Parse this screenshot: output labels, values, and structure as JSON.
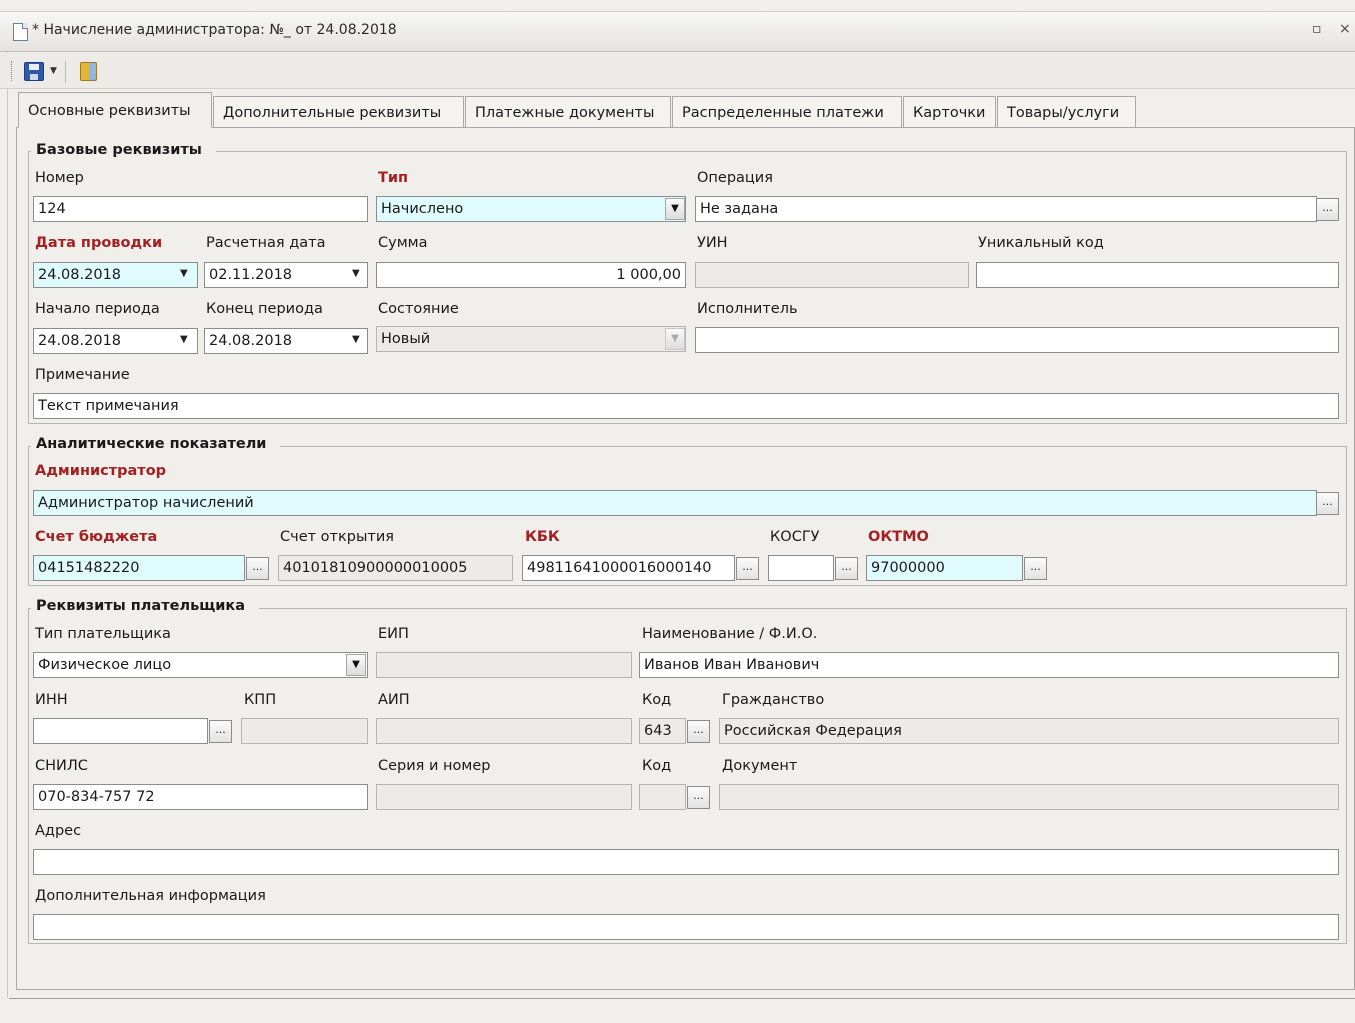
{
  "window": {
    "title": "* Начисление администратора: №_ от 24.08.2018",
    "restore_glyph": "▫",
    "close_glyph": "×"
  },
  "toolbar": {
    "save_icon": "save-icon",
    "exit_icon": "exit-icon"
  },
  "tabs": [
    "Основные реквизиты",
    "Дополнительные реквизиты",
    "Платежные документы",
    "Распределенные платежи",
    "Карточки",
    "Товары/услуги"
  ],
  "base": {
    "title": "Базовые реквизиты",
    "nomer_label": "Номер",
    "nomer_value": "124",
    "tip_label": "Тип",
    "tip_value": "Начислено",
    "operation_label": "Операция",
    "operation_value": "Не задана",
    "date_label": "Дата проводки",
    "date_value": "24.08.2018",
    "calc_date_label": "Расчетная дата",
    "calc_date_value": "02.11.2018",
    "sum_label": "Сумма",
    "sum_value": "1 000,00",
    "uin_label": "УИН",
    "uin_value": "",
    "unique_label": "Уникальный код",
    "unique_value": "",
    "period_start_label": "Начало периода",
    "period_start_value": "24.08.2018",
    "period_end_label": "Конец периода",
    "period_end_value": "24.08.2018",
    "state_label": "Состояние",
    "state_value": "Новый",
    "executor_label": "Исполнитель",
    "executor_value": "",
    "note_label": "Примечание",
    "note_value": "Текст примечания"
  },
  "analytics": {
    "title": "Аналитические показатели",
    "admin_label": "Администратор",
    "admin_value": "Администратор начислений",
    "budget_label": "Счет бюджета",
    "budget_value": "04151482220",
    "open_label": "Счет открытия",
    "open_value": "40101810900000010005",
    "kbk_label": "КБК",
    "kbk_value": "49811641000016000140",
    "kosgu_label": "КОСГУ",
    "kosgu_value": "",
    "oktmo_label": "ОКТМО",
    "oktmo_value": "97000000"
  },
  "payer": {
    "title": "Реквизиты плательщика",
    "type_label": "Тип плательщика",
    "type_value": "Физическое лицо",
    "eip_label": "ЕИП",
    "eip_value": "",
    "name_label": "Наименование / Ф.И.О.",
    "name_value": "Иванов Иван Иванович",
    "inn_label": "ИНН",
    "inn_value": "",
    "kpp_label": "КПП",
    "kpp_value": "",
    "aip_label": "АИП",
    "aip_value": "",
    "code_label": "Код",
    "code_value": "643",
    "citizenship_label": "Гражданство",
    "citizenship_value": "Российская Федерация",
    "snils_label": "СНИЛС",
    "snils_value": "070-834-757 72",
    "series_label": "Серия и номер",
    "series_value": "",
    "doc_code_label": "Код",
    "doc_code_value": "",
    "document_label": "Документ",
    "document_value": "",
    "address_label": "Адрес",
    "address_value": "",
    "addinfo_label": "Дополнительная информация",
    "addinfo_value": ""
  },
  "glyphs": {
    "ellipsis": "...",
    "combo_arrow": "▼",
    "date_arrow": "▼"
  }
}
